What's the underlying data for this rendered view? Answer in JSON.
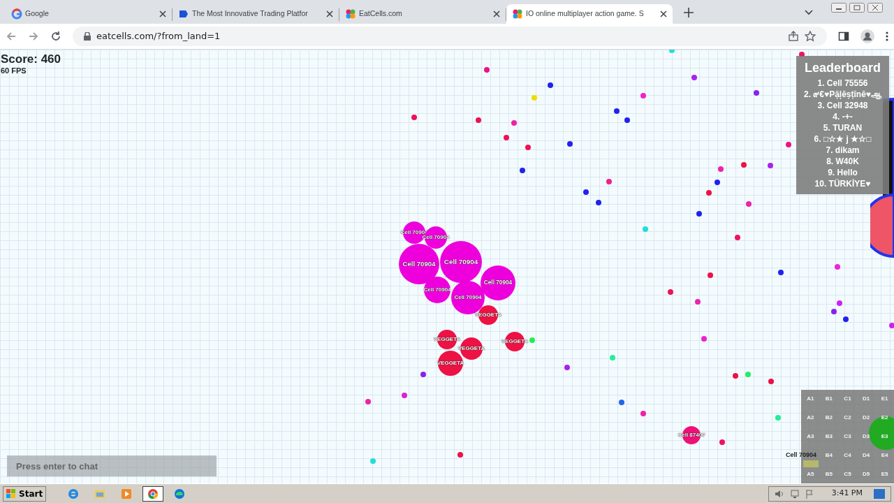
{
  "browser": {
    "tabs": [
      {
        "title": "Google",
        "kind": "g",
        "selected": false
      },
      {
        "title": "The Most Innovative Trading Platfor",
        "kind": "flag",
        "selected": false
      },
      {
        "title": "EatCells.com",
        "kind": "dots",
        "selected": false
      },
      {
        "title": "IO online multiplayer action game. S",
        "kind": "dots",
        "selected": true
      }
    ],
    "address": "eatcells.com/?from_land=1"
  },
  "game": {
    "score": "Score: 460",
    "fps": "60 FPS",
    "leaderboard": {
      "title": "Leaderboard",
      "entries": [
        "1. Cell 75556",
        "2. ๙€♥Pặļēṣṭīnē♥ஆ",
        "3. Cell 32948",
        "4. -+-",
        "5. TURAN",
        "6. □☆★ j ★☆□",
        "7. dikam",
        "8. W40K",
        "9. Hello",
        "10. TÜRKİYE♥"
      ]
    },
    "cells": [
      {
        "label": "Cell 70904",
        "color": "#ee00dd"
      },
      {
        "label": "Cell 70904",
        "color": "#ee00dd"
      },
      {
        "label": "Cell 70904",
        "color": "#ee00dd"
      },
      {
        "label": "Cell 70904",
        "color": "#ee00dd"
      },
      {
        "label": "Cell 70904",
        "color": "#ee00dd"
      },
      {
        "label": "Cell 70904",
        "color": "#ee00dd"
      },
      {
        "label": "Cell 70904",
        "color": "#ee00dd"
      },
      {
        "label": "VEGGETA",
        "color": "#ee1144"
      },
      {
        "label": "VEGGETA",
        "color": "#ee1144"
      },
      {
        "label": "VEGGETA",
        "color": "#ee1144"
      },
      {
        "label": "VEGGETA",
        "color": "#ee1144"
      },
      {
        "label": "VEGGETA",
        "color": "#ee1144"
      },
      {
        "label": "Cell 87407",
        "color": "#ee1177"
      }
    ],
    "chat": {
      "placeholder": "Press enter to chat"
    },
    "minimap": {
      "labels": [
        [
          "A1",
          "B1",
          "C1",
          "D1",
          "E1"
        ],
        [
          "A2",
          "B2",
          "C2",
          "D2",
          "E2"
        ],
        [
          "A3",
          "B3",
          "C3",
          "D3",
          "E3"
        ],
        [
          "B4",
          "C4",
          "D4",
          "E4"
        ],
        [
          "A5",
          "B5",
          "C5",
          "D5",
          "E5"
        ]
      ],
      "player_label": "Cell 70904"
    }
  },
  "taskbar": {
    "start": "Start",
    "apps": [
      {
        "kind": "ie",
        "selected": false
      },
      {
        "kind": "folder",
        "selected": false
      },
      {
        "kind": "media",
        "selected": false
      },
      {
        "kind": "chrome",
        "selected": true
      },
      {
        "kind": "edge",
        "selected": false
      }
    ],
    "clock": "3:41 PM"
  }
}
